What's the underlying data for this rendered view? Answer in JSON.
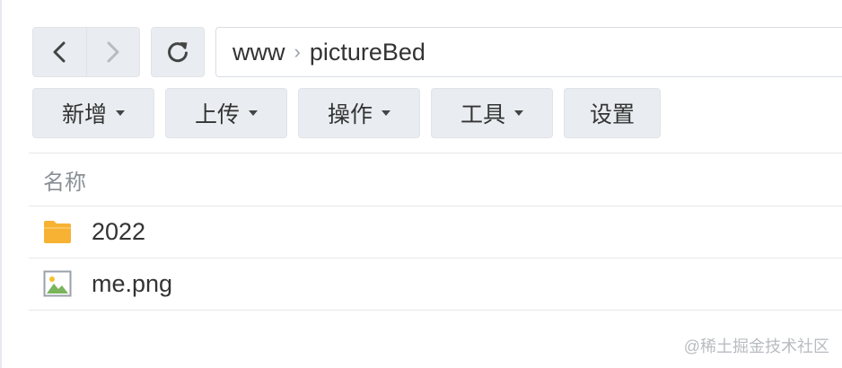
{
  "nav": {
    "back_icon": "chevron-left-icon",
    "forward_icon": "chevron-right-icon",
    "refresh_icon": "refresh-icon"
  },
  "breadcrumb": {
    "items": [
      "www",
      "pictureBed"
    ],
    "separator": "›"
  },
  "toolbar": {
    "new_label": "新增",
    "upload_label": "上传",
    "action_label": "操作",
    "tools_label": "工具",
    "settings_label": "设置"
  },
  "list": {
    "column_name": "名称",
    "items": [
      {
        "name": "2022",
        "icon": "folder-icon"
      },
      {
        "name": "me.png",
        "icon": "image-file-icon"
      }
    ]
  },
  "watermark": "@稀土掘金技术社区",
  "colors": {
    "button_bg": "#e9edf1",
    "folder": "#f7b233",
    "image_green": "#7ab55c"
  }
}
